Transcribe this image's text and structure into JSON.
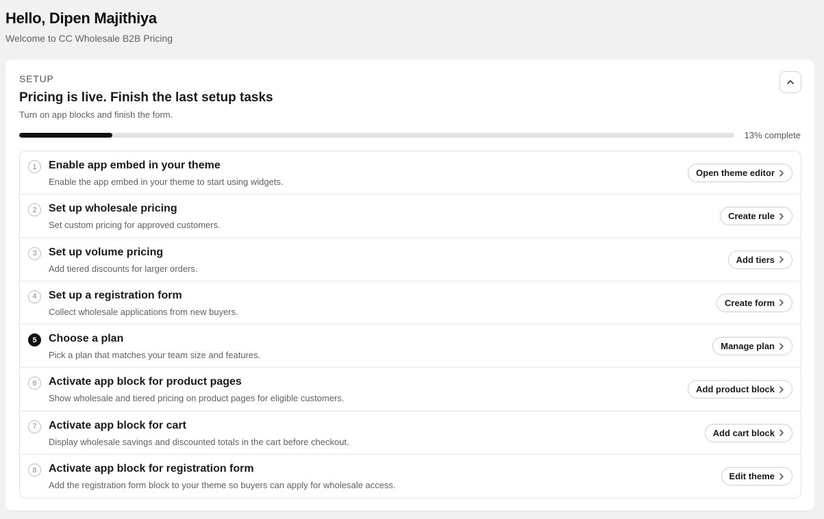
{
  "header": {
    "greeting": "Hello, Dipen Majithiya",
    "welcome": "Welcome to CC Wholesale B2B Pricing"
  },
  "setup": {
    "label": "SETUP",
    "title": "Pricing is live. Finish the last setup tasks",
    "subtitle": "Turn on app blocks and finish the form.",
    "progress_fraction": 0.13,
    "progress_text": "13% complete",
    "collapse_icon": "chevron-up-icon"
  },
  "tasks": [
    {
      "num": "1",
      "title": "Enable app embed in your theme",
      "desc": "Enable the app embed in your theme to start using widgets.",
      "button": "Open theme editor",
      "active": false
    },
    {
      "num": "2",
      "title": "Set up wholesale pricing",
      "desc": "Set custom pricing for approved customers.",
      "button": "Create rule",
      "active": false
    },
    {
      "num": "3",
      "title": "Set up volume pricing",
      "desc": "Add tiered discounts for larger orders.",
      "button": "Add tiers",
      "active": false
    },
    {
      "num": "4",
      "title": "Set up a registration form",
      "desc": "Collect wholesale applications from new buyers.",
      "button": "Create form",
      "active": false
    },
    {
      "num": "5",
      "title": "Choose a plan",
      "desc": "Pick a plan that matches your team size and features.",
      "button": "Manage plan",
      "active": true
    },
    {
      "num": "6",
      "title": "Activate app block for product pages",
      "desc": "Show wholesale and tiered pricing on product pages for eligible customers.",
      "button": "Add product block",
      "active": false
    },
    {
      "num": "7",
      "title": "Activate app block for cart",
      "desc": "Display wholesale savings and discounted totals in the cart before checkout.",
      "button": "Add cart block",
      "active": false
    },
    {
      "num": "8",
      "title": "Activate app block for registration form",
      "desc": "Add the registration form block to your theme so buyers can apply for wholesale access.",
      "button": "Edit theme",
      "active": false
    }
  ]
}
